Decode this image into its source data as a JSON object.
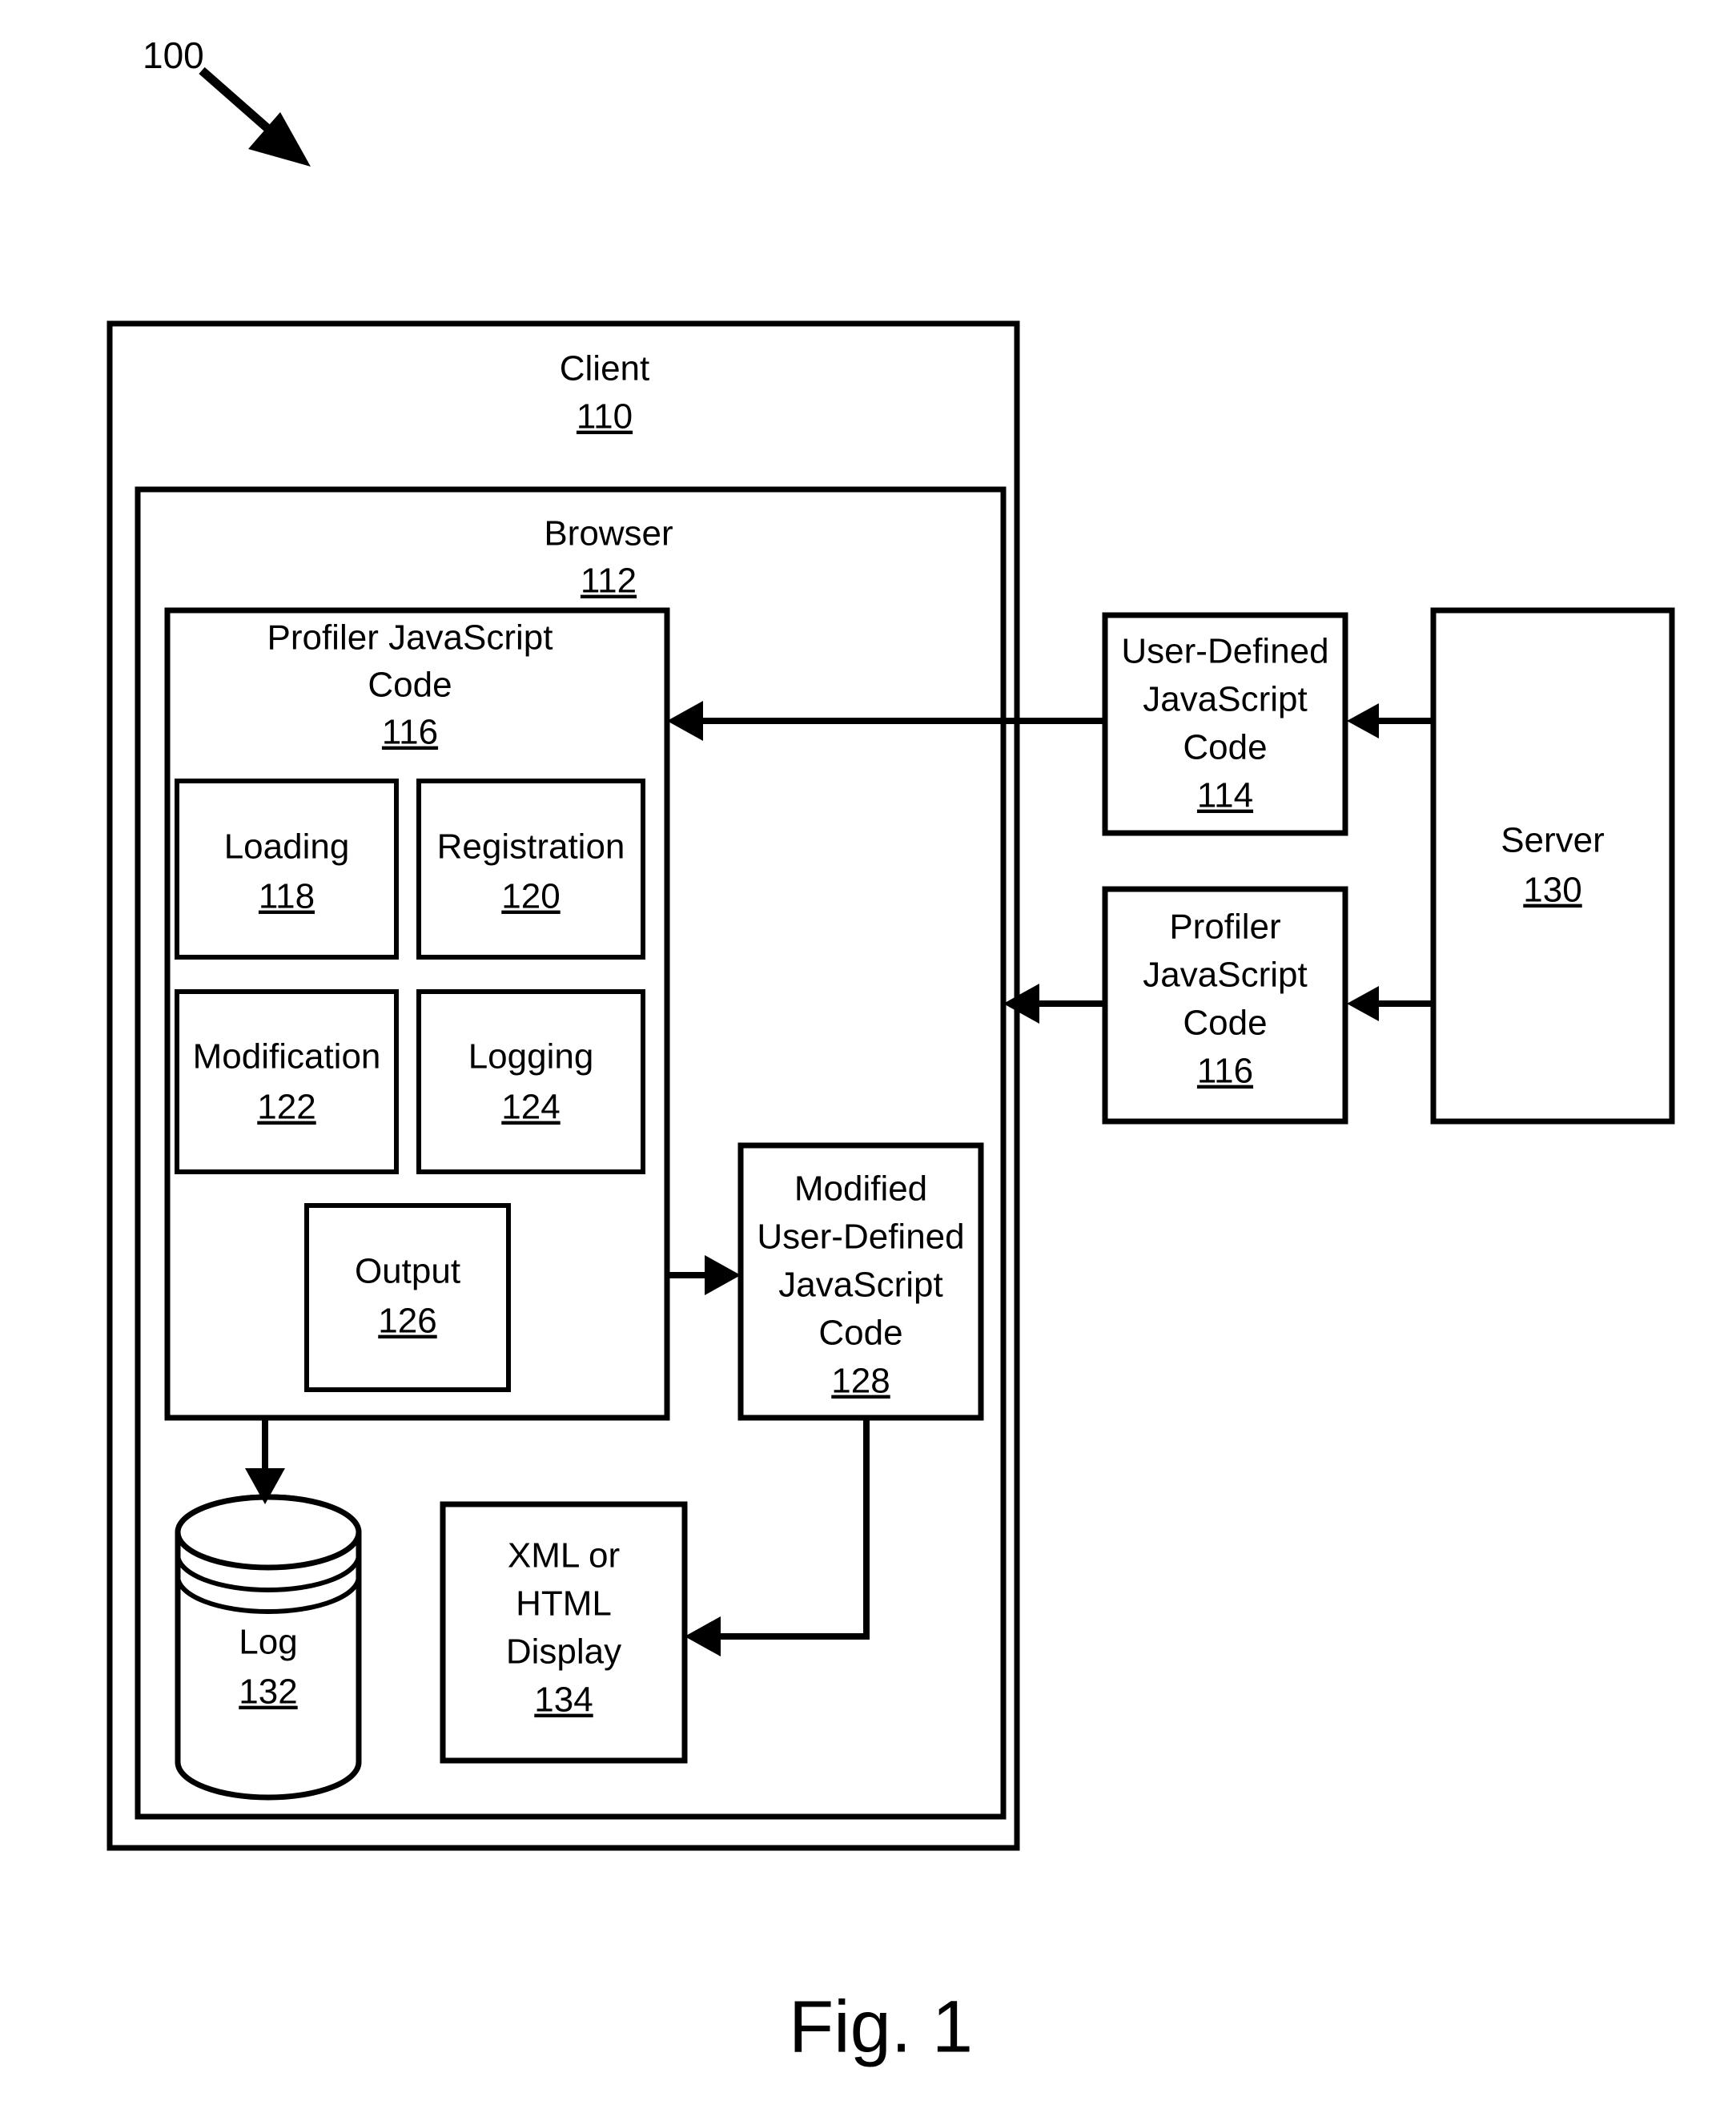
{
  "figure": {
    "reference_numeral": "100",
    "caption": "Fig. 1"
  },
  "blocks": {
    "client": {
      "label": "Client",
      "number": "110"
    },
    "browser": {
      "label": "Browser",
      "number": "112"
    },
    "profiler_js_code_client": {
      "label_line1": "Profiler JavaScript",
      "label_line2": "Code",
      "number": "116"
    },
    "loading": {
      "label": "Loading",
      "number": "118"
    },
    "registration": {
      "label": "Registration",
      "number": "120"
    },
    "modification": {
      "label": "Modification",
      "number": "122"
    },
    "logging": {
      "label": "Logging",
      "number": "124"
    },
    "output": {
      "label": "Output",
      "number": "126"
    },
    "modified_user_defined_js_code": {
      "label_line1": "Modified",
      "label_line2": "User-Defined",
      "label_line3": "JavaScript",
      "label_line4": "Code",
      "number": "128"
    },
    "log": {
      "label": "Log",
      "number": "132"
    },
    "xml_html_display": {
      "label_line1": "XML or",
      "label_line2": "HTML",
      "label_line3": "Display",
      "number": "134"
    },
    "user_defined_js_code": {
      "label_line1": "User-Defined",
      "label_line2": "JavaScript",
      "label_line3": "Code",
      "number": "114"
    },
    "profiler_js_code_server": {
      "label_line1": "Profiler",
      "label_line2": "JavaScript",
      "label_line3": "Code",
      "number": "116"
    },
    "server": {
      "label": "Server",
      "number": "130"
    }
  },
  "colors": {
    "stroke": "#000000",
    "fill": "#ffffff"
  }
}
